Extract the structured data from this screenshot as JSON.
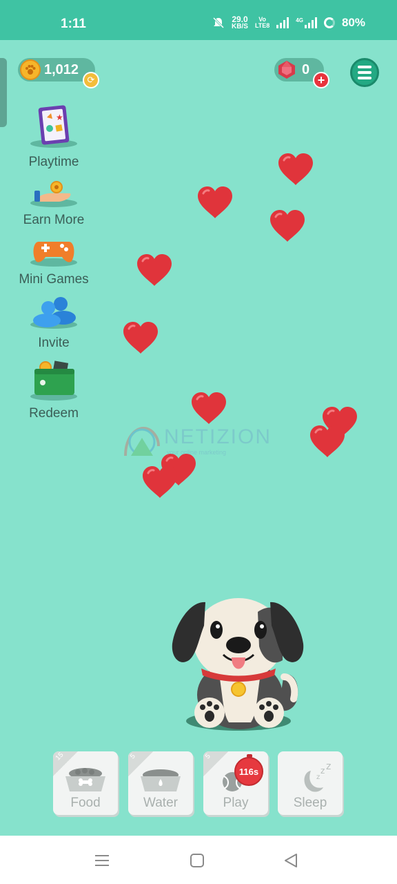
{
  "status_bar": {
    "time": "1:11",
    "net_speed_value": "29.0",
    "net_speed_unit": "KB/S",
    "volte_top": "Vo",
    "volte_bottom": "LTE8",
    "network": "4G",
    "battery": "80%"
  },
  "wallet": {
    "coins": "1,012",
    "gems": "0"
  },
  "side_menu": [
    {
      "label": "Playtime",
      "icon": "playtime-tablet-icon"
    },
    {
      "label": "Earn More",
      "icon": "earn-hand-coin-icon"
    },
    {
      "label": "Mini Games",
      "icon": "gamepad-icon"
    },
    {
      "label": "Invite",
      "icon": "people-icon"
    },
    {
      "label": "Redeem",
      "icon": "wallet-icon"
    }
  ],
  "watermark": {
    "text": "NETIZION",
    "sub": "your online marketing"
  },
  "actions": [
    {
      "label": "Food",
      "corner": "15",
      "icon": "food-bowl-icon"
    },
    {
      "label": "Water",
      "corner": "5",
      "icon": "water-bowl-icon"
    },
    {
      "label": "Play",
      "corner": "5",
      "icon": "ball-icon"
    },
    {
      "label": "Sleep",
      "corner": "",
      "icon": "moon-sleep-icon"
    }
  ],
  "play_timer": "116s",
  "colors": {
    "background": "#86e2cc",
    "status_bar": "#3fc3a3",
    "heart": "#e0343b",
    "coin": "#f6b52a",
    "gem": "#e8343d"
  }
}
